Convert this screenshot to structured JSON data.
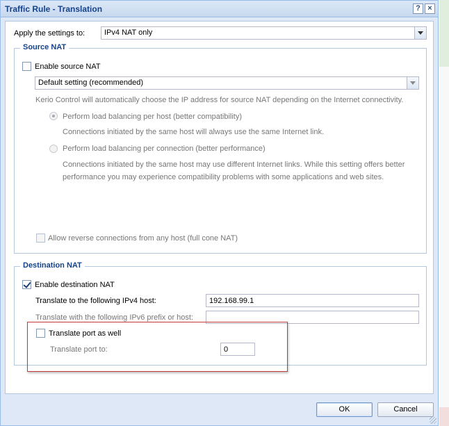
{
  "window": {
    "title": "Traffic Rule - Translation",
    "help_symbol": "?",
    "close_symbol": "×"
  },
  "apply": {
    "label": "Apply the settings to:",
    "value": "IPv4 NAT only"
  },
  "source_nat": {
    "legend": "Source NAT",
    "enable_label": "Enable source NAT",
    "enable_checked": false,
    "mode_value": "Default setting (recommended)",
    "description": "Kerio Control will automatically choose the IP address for source NAT depending on the Internet connectivity.",
    "options": [
      {
        "label": "Perform load balancing per host (better compatibility)",
        "description": "Connections initiated by the same host will always use the same Internet link.",
        "selected": true
      },
      {
        "label": "Perform load balancing per connection (better performance)",
        "description_line1": "Connections initiated by the same host may use different Internet links. While this setting offers better",
        "description_line2": "performance you may experience compatibility problems with some applications and web sites.",
        "selected": false
      }
    ],
    "reverse_label": "Allow reverse connections from any host (full cone NAT)",
    "reverse_checked": false
  },
  "destination_nat": {
    "legend": "Destination NAT",
    "enable_label": "Enable destination NAT",
    "enable_checked": true,
    "ipv4_label": "Translate to the following IPv4 host:",
    "ipv4_value": "192.168.99.1",
    "ipv6_label": "Translate with the following IPv6 prefix or host:",
    "ipv6_value": "",
    "port_label": "Translate port as well",
    "port_checked": false,
    "port_to_label": "Translate port to:",
    "port_to_value": "0"
  },
  "footer": {
    "ok_label": "OK",
    "cancel_label": "Cancel"
  },
  "colors": {
    "title_text": "#15428b",
    "highlight_border": "#c0393b",
    "dialog_bg": "#dfe8f6"
  }
}
